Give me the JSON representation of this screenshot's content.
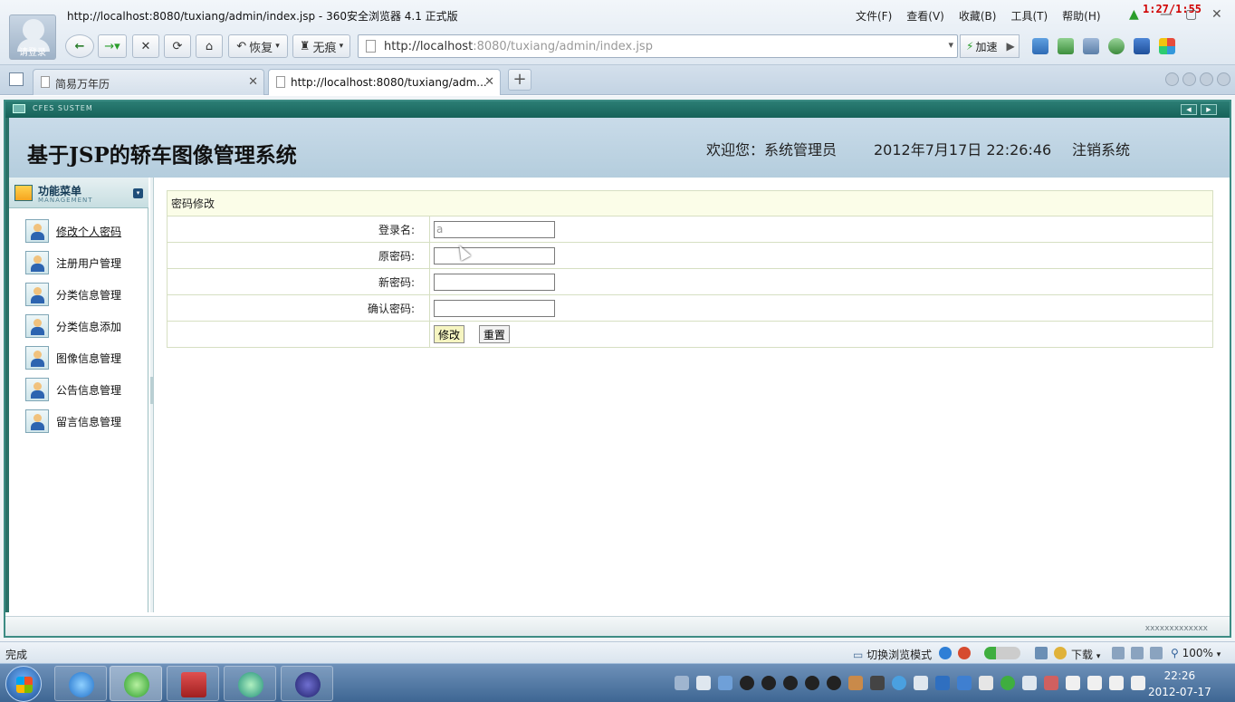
{
  "browser": {
    "window_title": "http://localhost:8080/tuxiang/admin/index.jsp - 360安全浏览器 4.1 正式版",
    "avatar_label": "请登录",
    "menus": [
      "文件(F)",
      "查看(V)",
      "收藏(B)",
      "工具(T)",
      "帮助(H)"
    ],
    "timer": "1:27/1:55",
    "restore_label": "恢复",
    "traceless_label": "无痕",
    "address_host": "http://localhost",
    "address_rest": ":8080/tuxiang/admin/index.jsp",
    "speed_label": "加速",
    "tabs": [
      {
        "label": "简易万年历",
        "active": false
      },
      {
        "label": "http://localhost:8080/tuxiang/adm...",
        "active": true
      }
    ]
  },
  "app": {
    "sysbar_text": "CFES SUSTEM",
    "title": "基于JSP的轿车图像管理系统",
    "welcome": "欢迎您：系统管理员",
    "datetime": "2012年7月17日  22:26:46",
    "logout": "注销系统",
    "menu_title": "功能菜单",
    "menu_subtitle": "MANAGEMENT",
    "menu_items": [
      {
        "label": "修改个人密码"
      },
      {
        "label": "注册用户管理"
      },
      {
        "label": "分类信息管理"
      },
      {
        "label": "分类信息添加"
      },
      {
        "label": "图像信息管理"
      },
      {
        "label": "公告信息管理"
      },
      {
        "label": "留言信息管理"
      }
    ],
    "form": {
      "caption": "密码修改",
      "login_label": "登录名:",
      "login_value": "a",
      "old_label": "原密码:",
      "new_label": "新密码:",
      "confirm_label": "确认密码:",
      "submit_label": "修改",
      "reset_label": "重置"
    },
    "footer_text": "xxxxxxxxxxxxx"
  },
  "statusbar": {
    "status": "完成",
    "mode": "切换浏览模式",
    "download": "下载",
    "zoom": "100%"
  },
  "taskbar": {
    "time": "22:26",
    "date": "2012-07-17"
  }
}
